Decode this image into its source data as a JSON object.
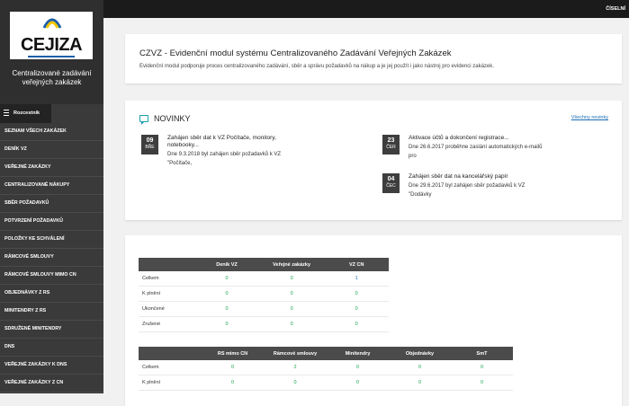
{
  "app": {
    "logo_text": "CEJIZA",
    "name_line1": "Centralizované zadávání",
    "name_line2": "veřejných zakázek"
  },
  "sidebar": {
    "toggle_label": "Rozcestník",
    "items": [
      {
        "label": "SEZNAM VŠECH ZAKÁZEK"
      },
      {
        "label": "DENÍK VZ"
      },
      {
        "label": "VEŘEJNÉ ZAKÁZKY"
      },
      {
        "label": "CENTRALIZOVANÉ NÁKUPY"
      },
      {
        "label": "SBĚR POŽADAVKŮ"
      },
      {
        "label": "POTVRZENÍ POŽADAVKŮ"
      },
      {
        "label": "POLOŽKY KE SCHVÁLENÍ"
      },
      {
        "label": "RÁMCOVÉ SMLOUVY"
      },
      {
        "label": "RÁMCOVÉ SMLOUVY MIMO CN"
      },
      {
        "label": "OBJEDNÁVKY Z RS"
      },
      {
        "label": "MINITENDRY Z RS"
      },
      {
        "label": "SDRUŽENÉ MINITENDRY"
      },
      {
        "label": "DNS"
      },
      {
        "label": "VEŘEJNÉ ZAKÁZKY K DNS"
      },
      {
        "label": "VEŘEJNÉ ZAKÁZKY Z CN"
      }
    ]
  },
  "topbar": {
    "right_item": "ČÍSELNÍ"
  },
  "header": {
    "title": "CZVZ - Evidenční modul systému Centralizovaného Zadávání Veřejných Zakázek",
    "description": "Evidenční modul podporuje proces centralizovaného zadávání, sběr a správu požadavků na nákup a je jej použít i jako nástroj pro evidenci zakázek."
  },
  "news": {
    "title": "NOVINKY",
    "all_link": "Všechny novinky",
    "items": [
      {
        "day": "09",
        "month": "BŘE",
        "headline_l1": "Zahájen sběr dat k VZ Počítače, monitory,",
        "headline_l2": "notebooky...",
        "text_l1": "Dne 9.3.2018 byl zahájen sběr požadavků k VZ",
        "text_l2": "\"Počítače,"
      },
      {
        "day": "23",
        "month": "ČER",
        "headline_l1": "Aktivace účtů a dokončení registrace...",
        "headline_l2": "",
        "text_l1": "Dne 26.6.2017 proběhne zaslání automatických e-mailů",
        "text_l2": "pro"
      },
      {
        "day": "04",
        "month": "ČEC",
        "headline_l1": "Zahájen sběr dat na kancelářský papír",
        "headline_l2": "",
        "text_l1": "Dne 29.6.2017 byl zahájen sběr požadavků k VZ",
        "text_l2": "\"Dodávky"
      }
    ]
  },
  "table1": {
    "headers": [
      "",
      "Deník VZ",
      "Veřejné zakázky",
      "VZ CN"
    ],
    "rows": [
      {
        "label": "Celkem",
        "v": [
          "0",
          "0",
          "1"
        ]
      },
      {
        "label": "K plnění",
        "v": [
          "0",
          "0",
          "0"
        ]
      },
      {
        "label": "Ukončené",
        "v": [
          "0",
          "0",
          "0"
        ]
      },
      {
        "label": "Zrušené",
        "v": [
          "0",
          "0",
          "0"
        ]
      }
    ]
  },
  "table2": {
    "headers": [
      "",
      "RS mimo CN",
      "Rámcové smlouvy",
      "Minitendry",
      "Objednávky",
      "SmT"
    ],
    "rows": [
      {
        "label": "Celkem",
        "v": [
          "0",
          "2",
          "0",
          "0",
          "0"
        ]
      },
      {
        "label": "K plnění",
        "v": [
          "0",
          "0",
          "0",
          "0",
          "0"
        ]
      }
    ]
  },
  "colors": {
    "accent": "#1a9cb5",
    "link": "#1a6fb5",
    "value_green": "#17a34a",
    "sidebar": "#3a3a3a"
  }
}
